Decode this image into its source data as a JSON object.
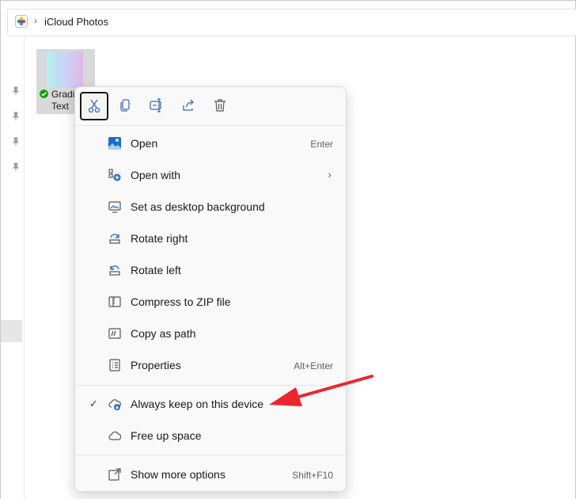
{
  "address_bar": {
    "location": "iCloud Photos"
  },
  "file": {
    "name_line1": "Gradi",
    "name_line2": "Text"
  },
  "toolbar": {
    "buttons": [
      {
        "icon": "scissors-icon",
        "name": "cut"
      },
      {
        "icon": "copy-icon",
        "name": "copy"
      },
      {
        "icon": "rename-icon",
        "name": "rename"
      },
      {
        "icon": "share-icon",
        "name": "share"
      },
      {
        "icon": "trash-icon",
        "name": "delete"
      }
    ]
  },
  "menu": {
    "items": [
      {
        "label": "Open",
        "shortcut": "Enter",
        "icon": "photos-app-icon"
      },
      {
        "label": "Open with",
        "icon": "open-with-icon",
        "submenu": true
      },
      {
        "label": "Set as desktop background",
        "icon": "desktop-background-icon"
      },
      {
        "label": "Rotate right",
        "icon": "rotate-right-icon"
      },
      {
        "label": "Rotate left",
        "icon": "rotate-left-icon"
      },
      {
        "label": "Compress to ZIP file",
        "icon": "zip-icon"
      },
      {
        "label": "Copy as path",
        "icon": "copy-path-icon"
      },
      {
        "label": "Properties",
        "shortcut": "Alt+Enter",
        "icon": "properties-icon"
      }
    ],
    "cloud_items": [
      {
        "label": "Always keep on this device",
        "icon": "cloud-download-icon",
        "checked": true
      },
      {
        "label": "Free up space",
        "icon": "cloud-icon"
      }
    ],
    "more": {
      "label": "Show more options",
      "shortcut": "Shift+F10",
      "icon": "show-more-icon"
    }
  },
  "annotation": {
    "color": "#e8272f"
  }
}
